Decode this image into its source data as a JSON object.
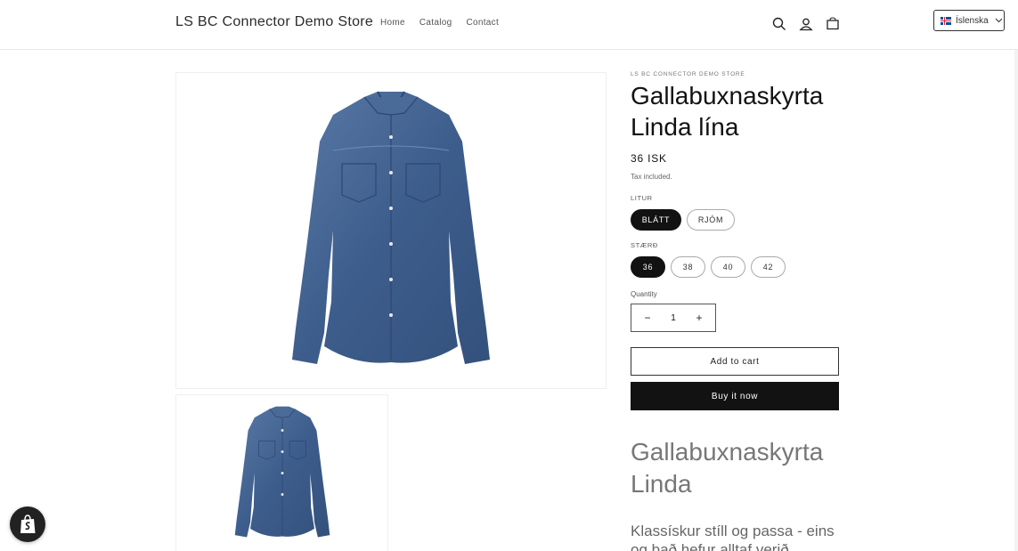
{
  "header": {
    "brand": "LS BC Connector Demo Store",
    "nav": [
      "Home",
      "Catalog",
      "Contact"
    ],
    "icons": [
      "search-icon",
      "account-icon",
      "cart-icon"
    ],
    "language": "Íslenska"
  },
  "product": {
    "vendor": "LS BC CONNECTOR DEMO STORE",
    "title": "Gallabuxnaskyrta Linda lína",
    "price": "36 ISK",
    "tax_note": "Tax included.",
    "color_label": "LITUR",
    "colors": [
      "BLÁTT",
      "RJÓM"
    ],
    "selected_color": "BLÁTT",
    "size_label": "STÆRÐ",
    "sizes": [
      "36",
      "38",
      "40",
      "42"
    ],
    "selected_size": "36",
    "quantity_label": "Quantity",
    "quantity": "1",
    "quantity_minus": "−",
    "quantity_plus": "+",
    "add_to_cart": "Add to cart",
    "buy_now": "Buy it now",
    "description_heading": "Gallabuxnaskyrta Linda",
    "description_text": "Klassískur stíll og passa - eins og það hefur alltaf verið"
  },
  "colors": {
    "accent": "#121212",
    "shirt": "#3f5f8f"
  }
}
